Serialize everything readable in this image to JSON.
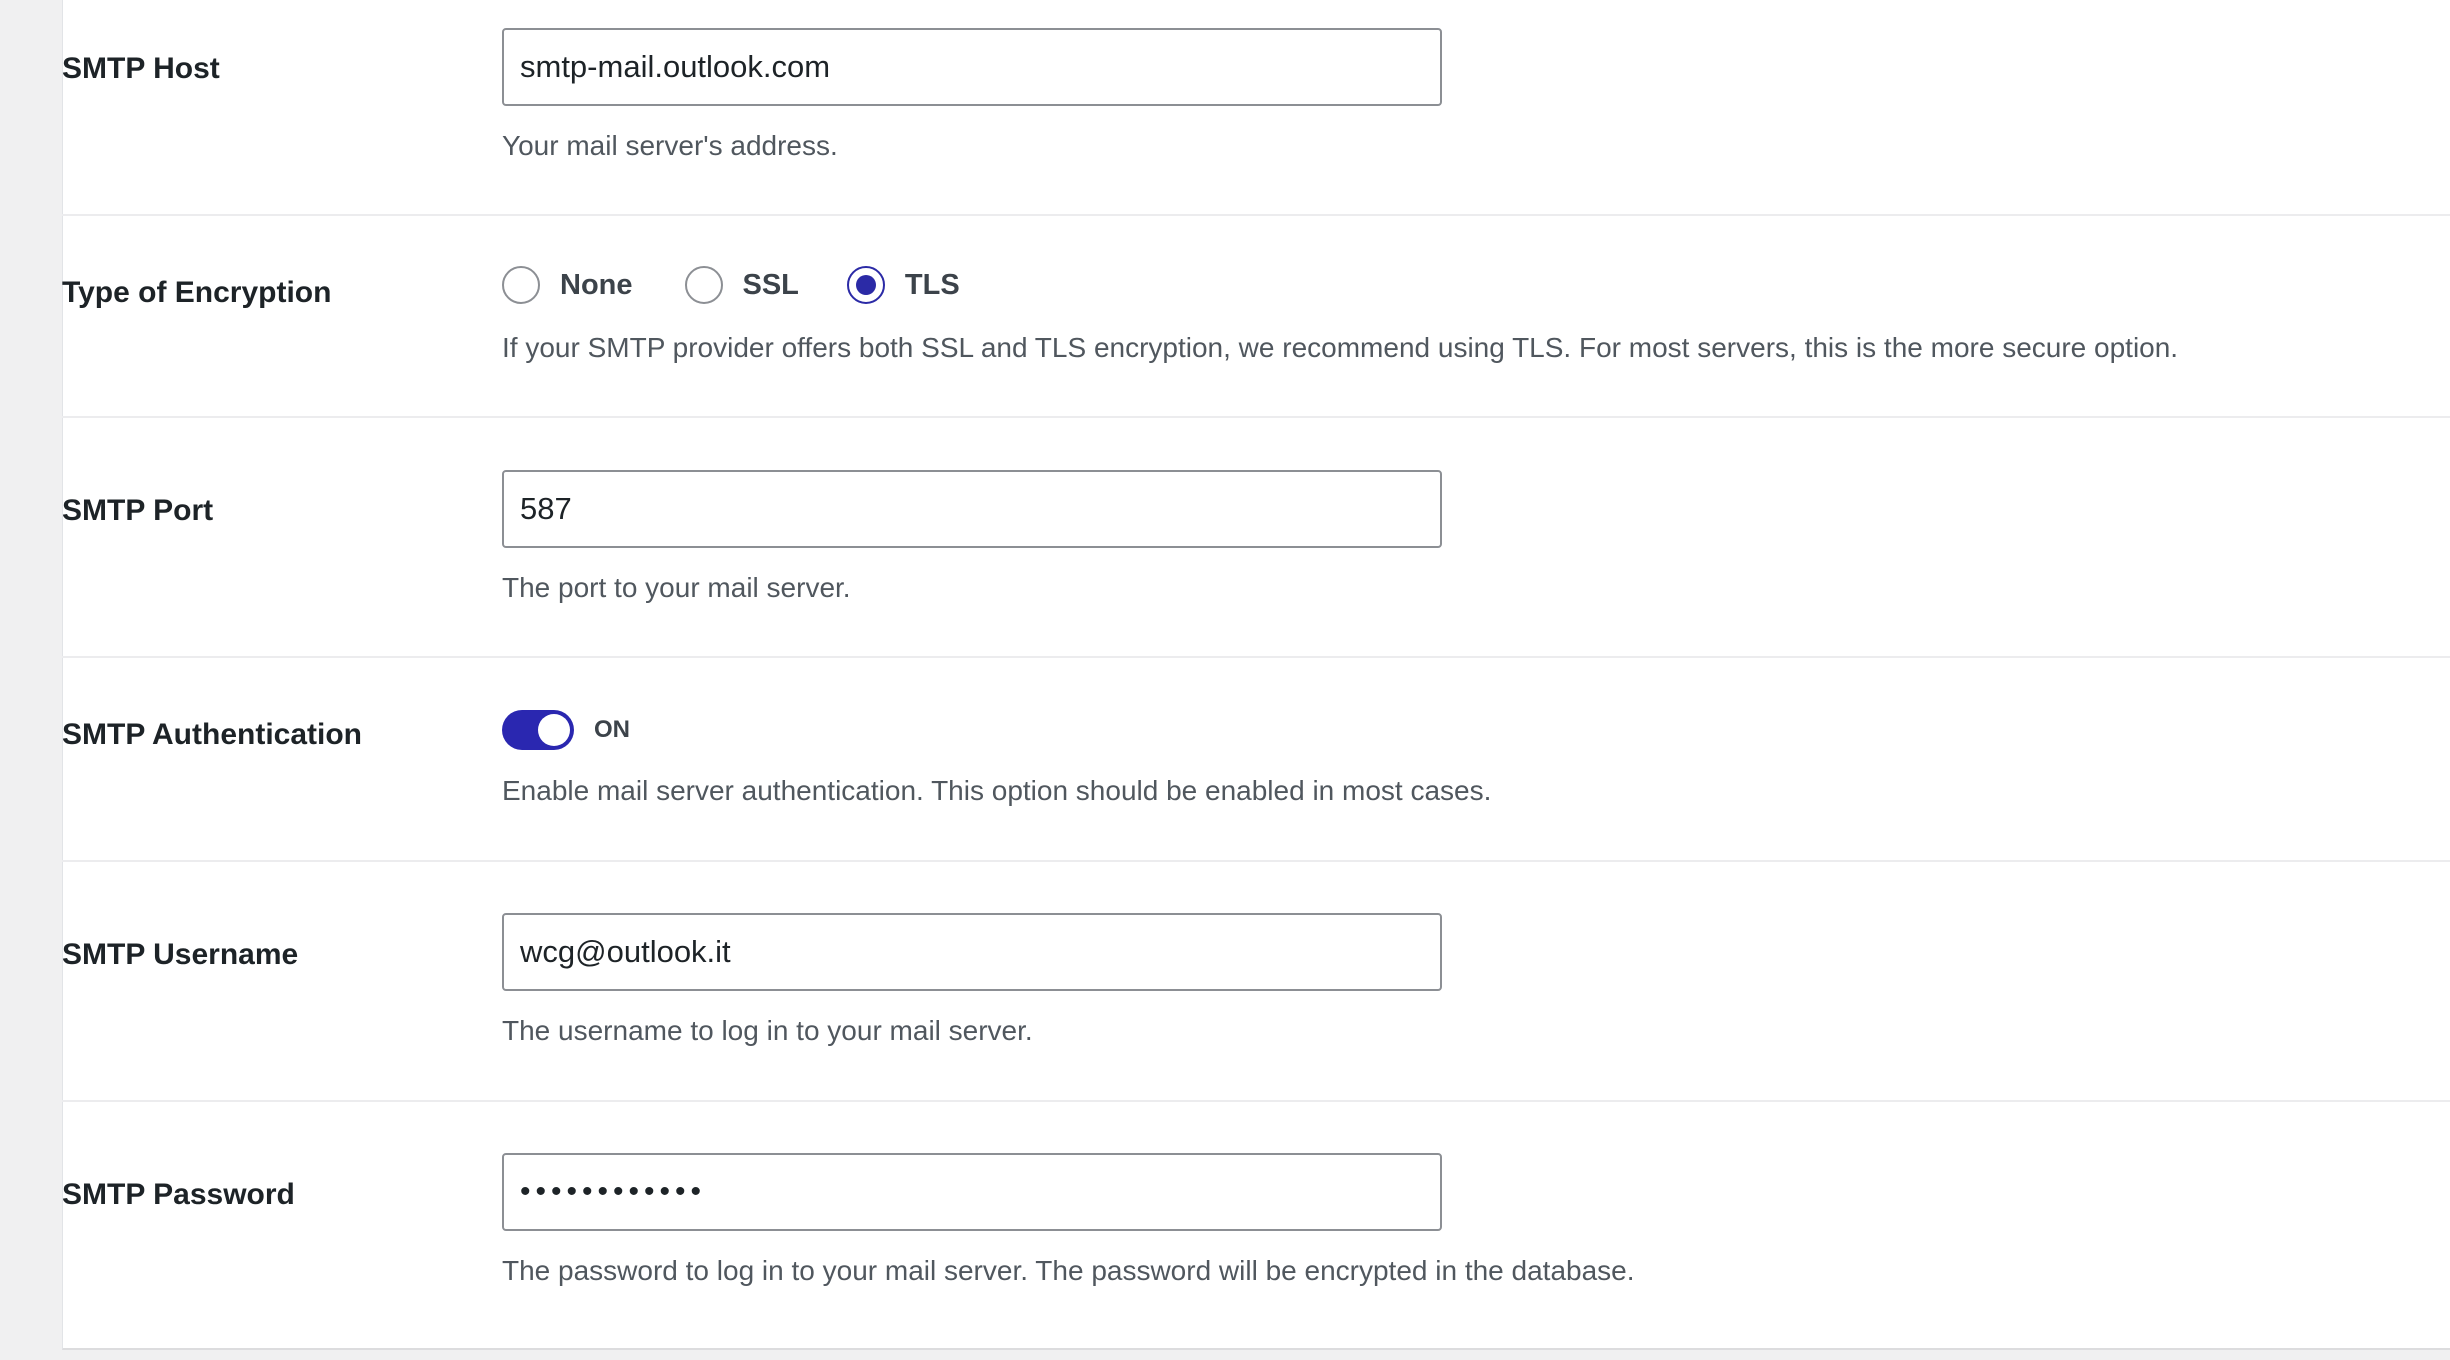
{
  "fields": {
    "host": {
      "label": "SMTP Host",
      "value": "smtp-mail.outlook.com",
      "description": "Your mail server's address."
    },
    "encryption": {
      "label": "Type of Encryption",
      "options": [
        "None",
        "SSL",
        "TLS"
      ],
      "selected": "TLS",
      "description": "If your SMTP provider offers both SSL and TLS encryption, we recommend using TLS. For most servers, this is the more secure option."
    },
    "port": {
      "label": "SMTP Port",
      "value": "587",
      "description": "The port to your mail server."
    },
    "authentication": {
      "label": "SMTP Authentication",
      "state_label": "ON",
      "enabled": true,
      "description": "Enable mail server authentication. This option should be enabled in most cases."
    },
    "username": {
      "label": "SMTP Username",
      "value": "wcg@outlook.it",
      "description": "The username to log in to your mail server."
    },
    "password": {
      "label": "SMTP Password",
      "value": "••••••••••••",
      "description": "The password to log in to your mail server. The password will be encrypted in the database."
    }
  },
  "colors": {
    "accent": "#2a27b0",
    "page_bg": "#f0f0f1",
    "panel_bg": "#ffffff",
    "description_text": "#50575e"
  }
}
